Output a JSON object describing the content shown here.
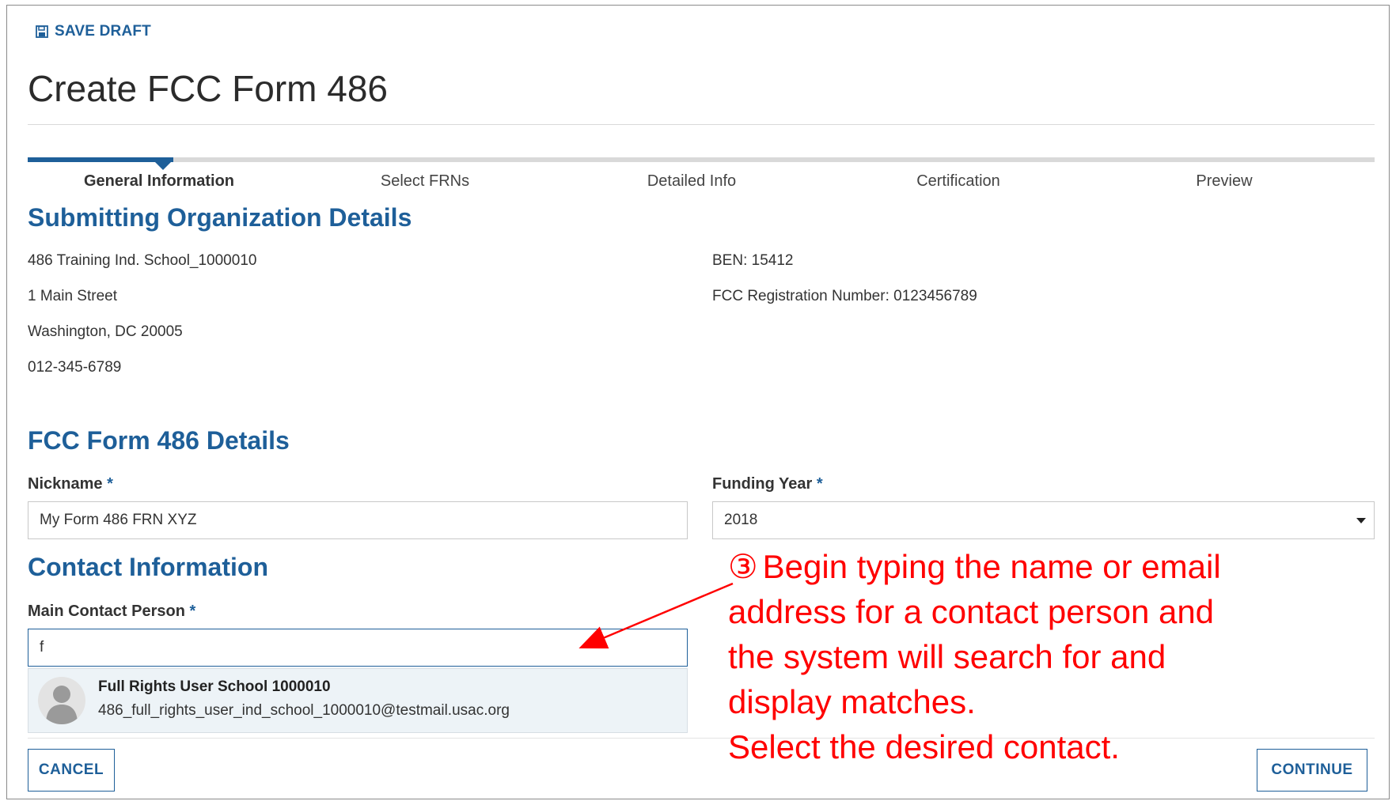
{
  "toolbar": {
    "save_draft_label": "SAVE DRAFT"
  },
  "page": {
    "title": "Create FCC Form 486"
  },
  "stepper": {
    "steps": [
      "General Information",
      "Select FRNs",
      "Detailed Info",
      "Certification",
      "Preview"
    ],
    "active_index": 0
  },
  "org": {
    "heading": "Submitting Organization Details",
    "name": "486 Training Ind. School_1000010",
    "street": "1 Main Street",
    "city": "Washington, DC 20005",
    "phone": "012-345-6789",
    "ben": "BEN: 15412",
    "frn": "FCC Registration Number: 0123456789"
  },
  "form486": {
    "heading": "FCC Form 486 Details",
    "nickname_label": "Nickname",
    "nickname_value": "My Form 486 FRN XYZ",
    "funding_year_label": "Funding Year",
    "funding_year_value": "2018",
    "required_mark": "*"
  },
  "contact": {
    "heading": "Contact Information",
    "main_contact_label": "Main Contact Person",
    "main_contact_value": "f",
    "suggestion": {
      "name": "Full Rights User School 1000010",
      "email": "486_full_rights_user_ind_school_1000010@testmail.usac.org"
    }
  },
  "buttons": {
    "cancel": "CANCEL",
    "continue": "CONTINUE"
  },
  "annotation": {
    "marker": "③",
    "line1": "Begin typing the name or email",
    "line2": "address for a contact person and",
    "line3": "the system will search for and",
    "line4": "display matches.",
    "line5": "Select the desired contact."
  },
  "colors": {
    "accent": "#1e5f99",
    "annotation": "#ff0000",
    "suggestion_bg": "#edf3f7"
  },
  "icons": {
    "save": "floppy-disk-icon",
    "dropdown": "caret-down-icon",
    "avatar": "user-silhouette-icon"
  }
}
